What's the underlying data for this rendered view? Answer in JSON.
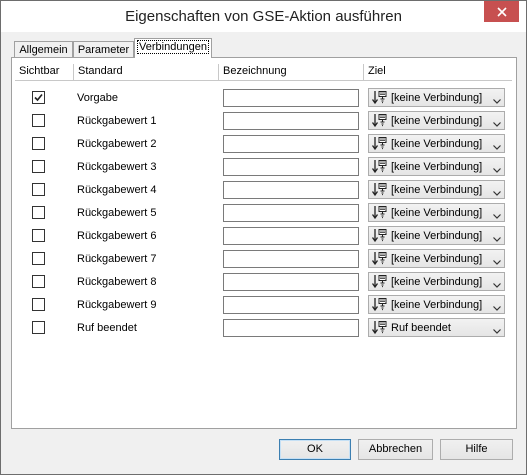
{
  "window": {
    "title": "Eigenschaften von GSE-Aktion ausführen"
  },
  "tabs": [
    {
      "label": "Allgemein",
      "active": false
    },
    {
      "label": "Parameter",
      "active": false
    },
    {
      "label": "Verbindungen",
      "active": true
    }
  ],
  "columns": {
    "sichtbar": "Sichtbar",
    "standard": "Standard",
    "bezeichnung": "Bezeichnung",
    "ziel": "Ziel"
  },
  "rows": [
    {
      "checked": true,
      "standard": "Vorgabe",
      "bezeichnung": "",
      "ziel": "[keine Verbindung]"
    },
    {
      "checked": false,
      "standard": "Rückgabewert 1",
      "bezeichnung": "",
      "ziel": "[keine Verbindung]"
    },
    {
      "checked": false,
      "standard": "Rückgabewert 2",
      "bezeichnung": "",
      "ziel": "[keine Verbindung]"
    },
    {
      "checked": false,
      "standard": "Rückgabewert 3",
      "bezeichnung": "",
      "ziel": "[keine Verbindung]"
    },
    {
      "checked": false,
      "standard": "Rückgabewert 4",
      "bezeichnung": "",
      "ziel": "[keine Verbindung]"
    },
    {
      "checked": false,
      "standard": "Rückgabewert 5",
      "bezeichnung": "",
      "ziel": "[keine Verbindung]"
    },
    {
      "checked": false,
      "standard": "Rückgabewert 6",
      "bezeichnung": "",
      "ziel": "[keine Verbindung]"
    },
    {
      "checked": false,
      "standard": "Rückgabewert 7",
      "bezeichnung": "",
      "ziel": "[keine Verbindung]"
    },
    {
      "checked": false,
      "standard": "Rückgabewert 8",
      "bezeichnung": "",
      "ziel": "[keine Verbindung]"
    },
    {
      "checked": false,
      "standard": "Rückgabewert 9",
      "bezeichnung": "",
      "ziel": "[keine Verbindung]"
    },
    {
      "checked": false,
      "standard": "Ruf beendet",
      "bezeichnung": "",
      "ziel": "Ruf beendet"
    }
  ],
  "buttons": {
    "ok": "OK",
    "cancel": "Abbrechen",
    "help": "Hilfe"
  },
  "icons": {
    "close": "close-icon",
    "connection": "connection-icon",
    "dropdown": "chevron-down-icon",
    "check": "checkmark-icon"
  },
  "colors": {
    "close_button": "#c75050",
    "default_button_border": "#3c7fb1"
  }
}
